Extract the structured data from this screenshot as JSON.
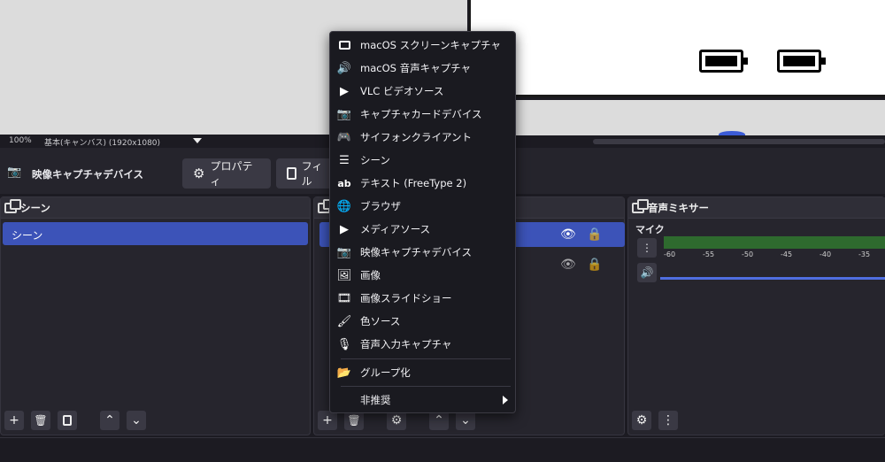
{
  "preview": {
    "zoom": "100%",
    "canvas_label": "基本(キャンバス) (1920x1080)"
  },
  "source_toolbar": {
    "current_source": "映像キャプチャデバイス",
    "properties_button": "プロパティ",
    "filters_button": "フィル"
  },
  "scenes_dock": {
    "title": "シーン",
    "items": [
      "シーン"
    ]
  },
  "mixer_dock": {
    "title": "音声ミキサー",
    "channel_name": "マイク",
    "ticks": [
      "-60",
      "-55",
      "-50",
      "-45",
      "-40",
      "-35"
    ]
  },
  "context_menu": {
    "items": [
      {
        "label": "macOS スクリーンキャプチャ",
        "icon": "monitor-icon"
      },
      {
        "label": "macOS 音声キャプチャ",
        "icon": "speaker-icon"
      },
      {
        "label": "VLC ビデオソース",
        "icon": "play-icon"
      },
      {
        "label": "キャプチャカードデバイス",
        "icon": "camera-icon"
      },
      {
        "label": "サイフォンクライアント",
        "icon": "gamepad-icon"
      },
      {
        "label": "シーン",
        "icon": "list-icon"
      },
      {
        "label": "テキスト (FreeType 2)",
        "icon": "text-icon"
      },
      {
        "label": "ブラウザ",
        "icon": "globe-icon"
      },
      {
        "label": "メディアソース",
        "icon": "play-icon"
      },
      {
        "label": "映像キャプチャデバイス",
        "icon": "camera-icon"
      },
      {
        "label": "画像",
        "icon": "image-icon"
      },
      {
        "label": "画像スライドショー",
        "icon": "slideshow-icon"
      },
      {
        "label": "色ソース",
        "icon": "brush-icon"
      },
      {
        "label": "音声入力キャプチャ",
        "icon": "microphone-icon"
      }
    ],
    "group_item": "グループ化",
    "deprecated_item": "非推奨"
  },
  "colors": {
    "accent": "#3c53b8",
    "meter_green": "#2e6a2e",
    "background": "#1c1b22"
  }
}
